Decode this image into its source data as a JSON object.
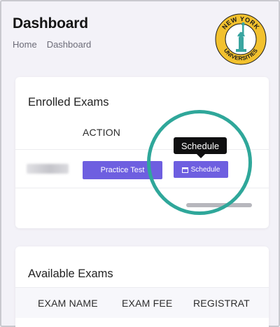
{
  "header": {
    "title": "Dashboard",
    "breadcrumb": [
      "Home",
      "Dashboard"
    ],
    "logo": {
      "top_text": "NEW YORK",
      "bottom_text": "UNIVERSITIES",
      "colors": {
        "ring": "#f2c12e",
        "inner": "#ffffff",
        "statue": "#3aa5a0",
        "text": "#1a1a1a"
      }
    }
  },
  "enrolled": {
    "title": "Enrolled Exams",
    "columns": [
      "ACTION"
    ],
    "row": {
      "practice_label": "Practice Test",
      "schedule_label": "Schedule"
    },
    "tooltip": "Schedule"
  },
  "available": {
    "title": "Available Exams",
    "columns": [
      "EXAM NAME",
      "EXAM FEE",
      "REGISTRAT"
    ]
  },
  "colors": {
    "accent": "#6e5fe0",
    "highlight_ring": "#2fa79a",
    "background": "#f3f2f8"
  }
}
